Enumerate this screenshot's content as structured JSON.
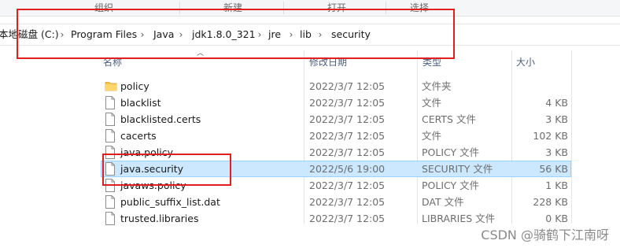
{
  "ribbon": {
    "groups": [
      "组织",
      "新建",
      "打开",
      "选择"
    ]
  },
  "breadcrumb": [
    "本地磁盘 (C:)",
    "Program Files",
    "Java",
    "jdk1.8.0_321",
    "jre",
    "lib",
    "security"
  ],
  "columns": {
    "name": "名称",
    "date": "修改日期",
    "type": "类型",
    "size": "大小"
  },
  "files": [
    {
      "name": "policy",
      "date": "2022/3/7 12:05",
      "type": "文件夹",
      "size": "",
      "icon": "folder-icon"
    },
    {
      "name": "blacklist",
      "date": "2022/3/7 12:05",
      "type": "文件",
      "size": "4 KB",
      "icon": "file-icon"
    },
    {
      "name": "blacklisted.certs",
      "date": "2022/3/7 12:05",
      "type": "CERTS 文件",
      "size": "3 KB",
      "icon": "file-icon"
    },
    {
      "name": "cacerts",
      "date": "2022/3/7 12:05",
      "type": "文件",
      "size": "102 KB",
      "icon": "file-icon"
    },
    {
      "name": "java.policy",
      "date": "2022/3/7 12:05",
      "type": "POLICY 文件",
      "size": "3 KB",
      "icon": "file-icon"
    },
    {
      "name": "java.security",
      "date": "2022/5/6 19:00",
      "type": "SECURITY 文件",
      "size": "56 KB",
      "icon": "file-icon",
      "selected": true
    },
    {
      "name": "javaws.policy",
      "date": "2022/3/7 12:05",
      "type": "POLICY 文件",
      "size": "1 KB",
      "icon": "file-icon"
    },
    {
      "name": "public_suffix_list.dat",
      "date": "2022/3/7 12:05",
      "type": "DAT 文件",
      "size": "228 KB",
      "icon": "file-icon"
    },
    {
      "name": "trusted.libraries",
      "date": "2022/3/7 12:05",
      "type": "LIBRARIES 文件",
      "size": "0 KB",
      "icon": "file-icon"
    }
  ],
  "watermark": "CSDN @骑鹤下江南呀",
  "colors": {
    "selection": "#cce8ff",
    "annotation": "#e02020",
    "folder": "#f5c24a"
  }
}
